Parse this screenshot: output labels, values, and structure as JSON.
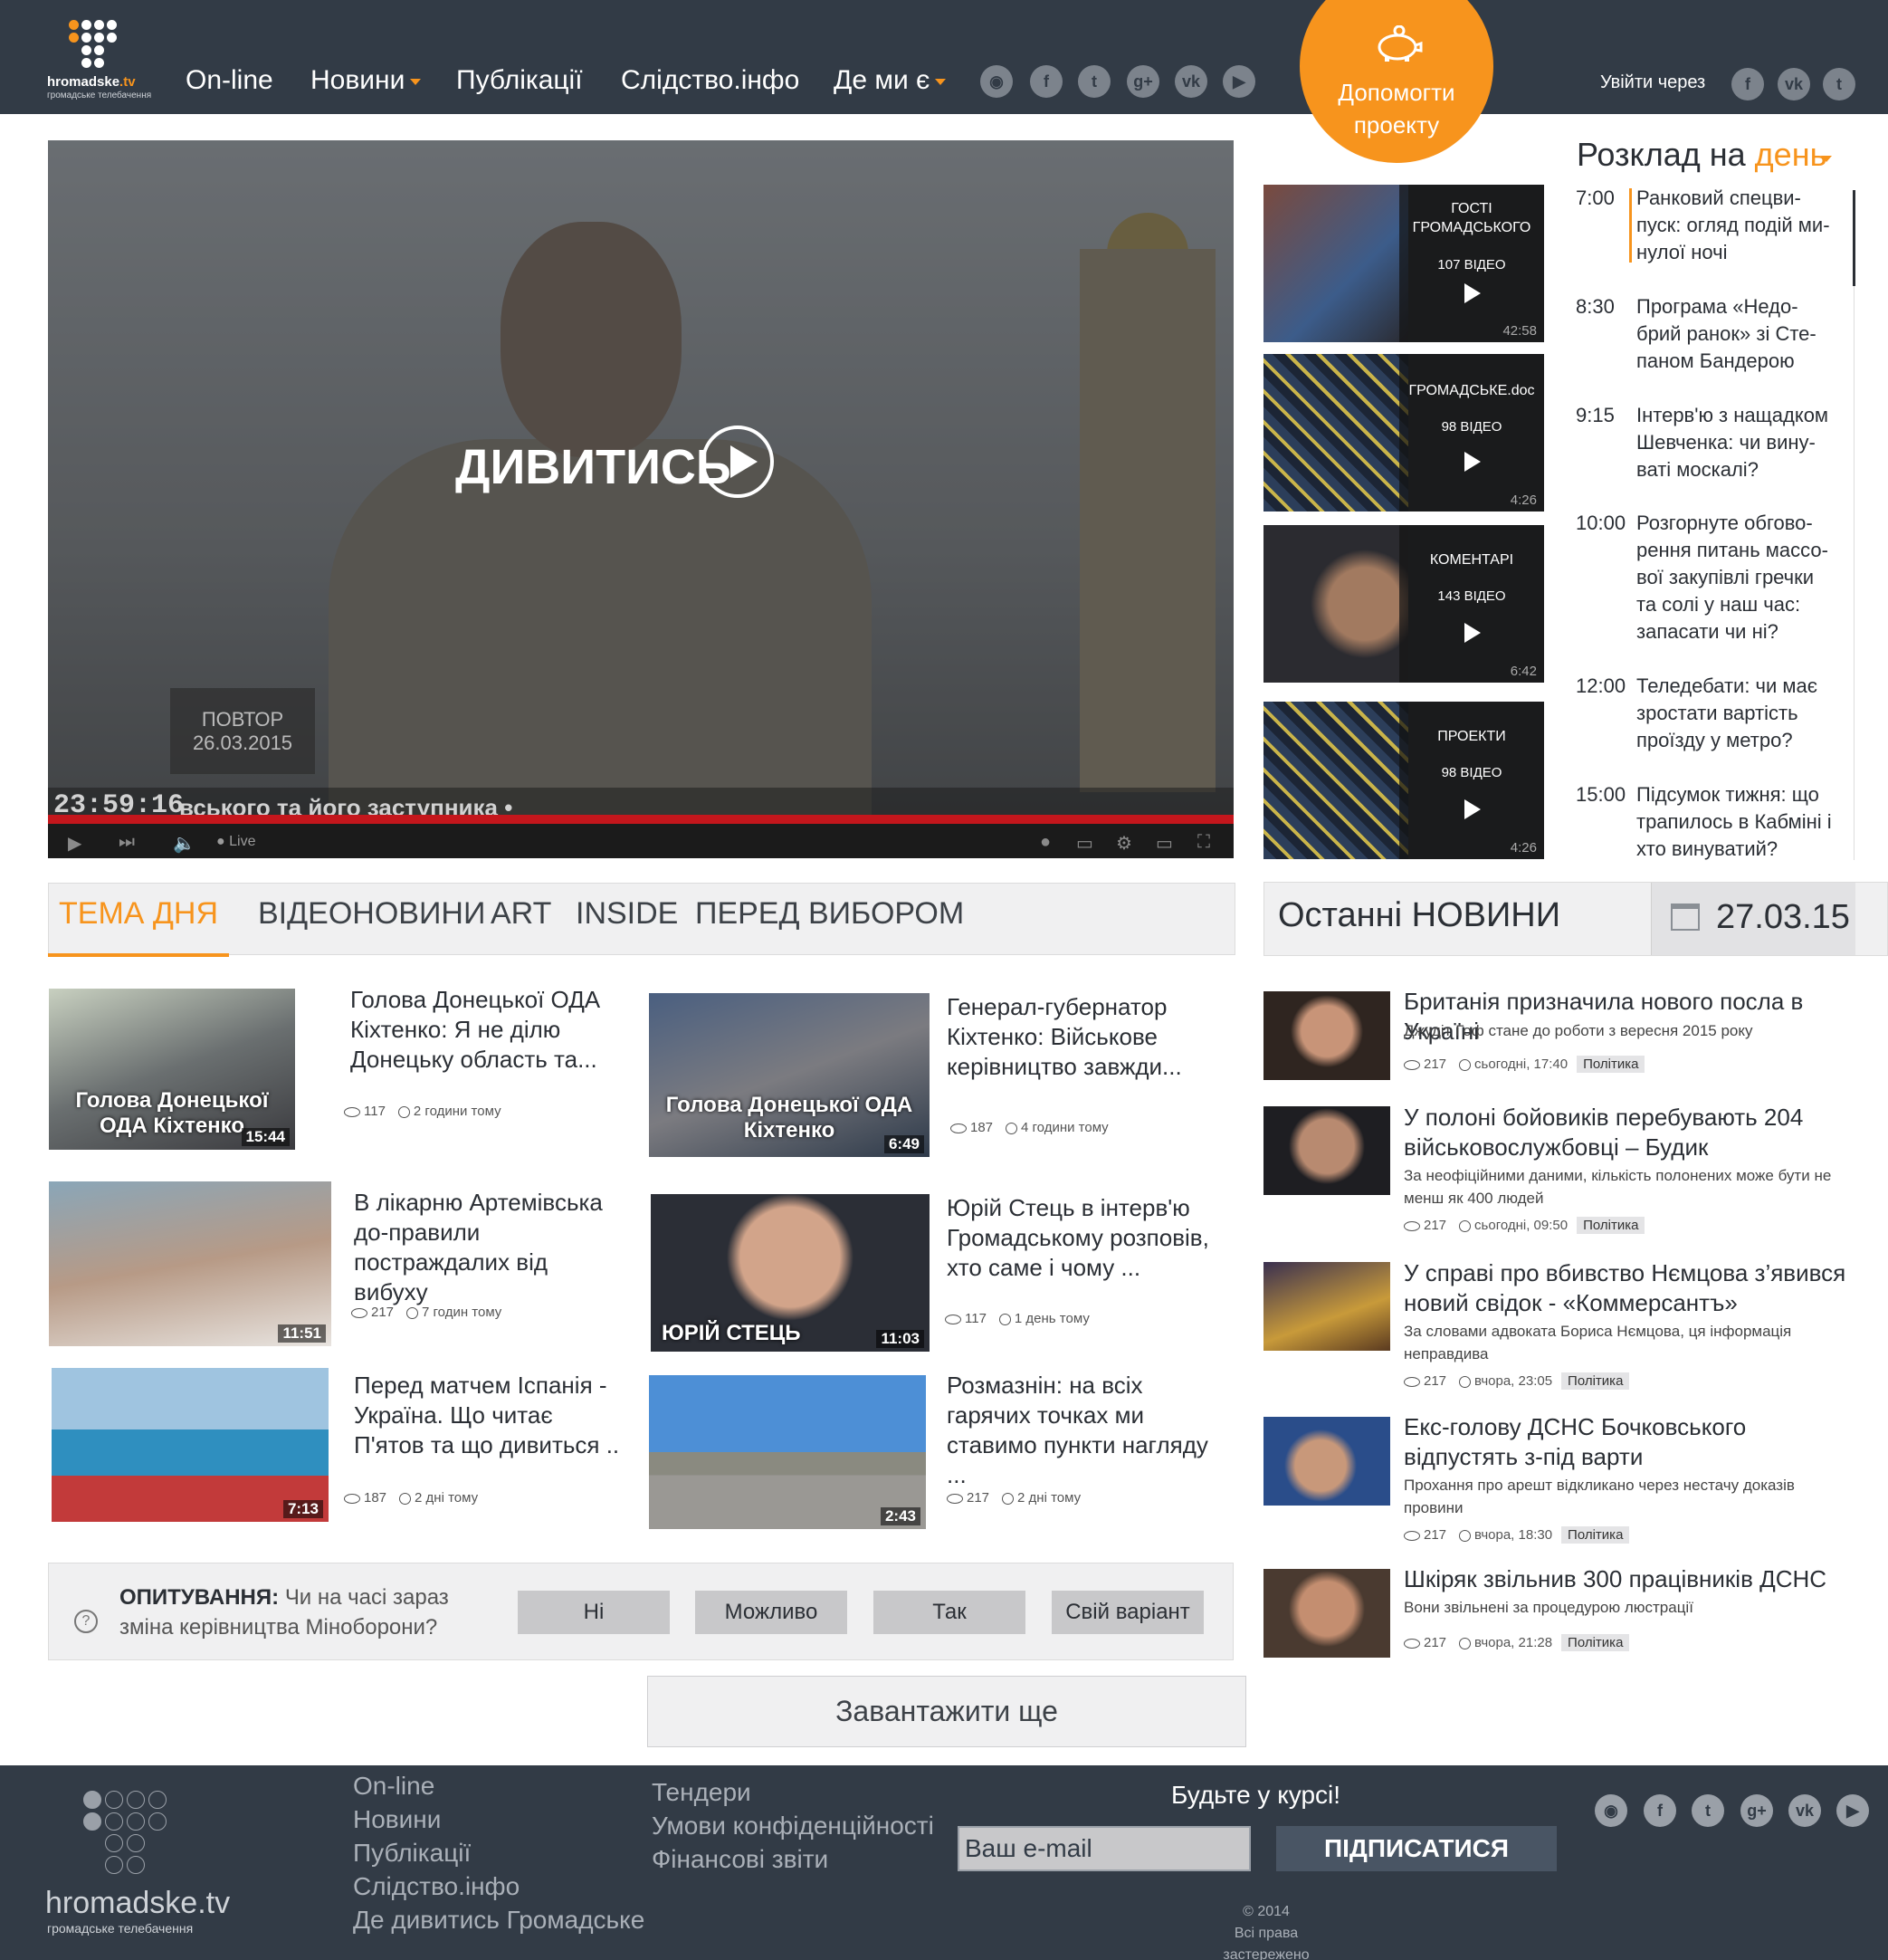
{
  "header": {
    "logo": {
      "name": "hromadske",
      "tld": ".tv",
      "sub": "громадське телебачення"
    },
    "nav": [
      {
        "label": "On-line",
        "dropdown": false
      },
      {
        "label": "Новини",
        "dropdown": true
      },
      {
        "label": "Публікації",
        "dropdown": false
      },
      {
        "label": "Слідство.інфо",
        "dropdown": false
      },
      {
        "label": "Де ми є",
        "dropdown": true
      }
    ],
    "social": [
      "rss-icon",
      "facebook-icon",
      "twitter-icon",
      "google-plus-icon",
      "vk-icon",
      "youtube-icon"
    ],
    "donate": {
      "line1": "Допомогти",
      "line2": "проекту",
      "icon": "piggy-bank-icon"
    },
    "login": {
      "label": "Увійти через",
      "providers": [
        "facebook-icon",
        "vk-icon",
        "twitter-icon"
      ]
    }
  },
  "player": {
    "watch_label": "ДИВИТИСЬ",
    "repeat_line1": "ПОВТОР",
    "repeat_line2": "26.03.2015",
    "clock": "23:59:16",
    "ticker": "вського та його заступника •",
    "live": "● Live"
  },
  "playlists": [
    {
      "title": "ГОСТІ ГРОМАДСЬКОГО",
      "count": "107 ВІДЕО",
      "duration": "42:58"
    },
    {
      "title": "ГРОМАДСЬКЕ.doc",
      "count": "98 ВІДЕО",
      "duration": "4:26"
    },
    {
      "title": "КОМЕНТАРІ",
      "count": "143 ВІДЕО",
      "duration": "6:42"
    },
    {
      "title": "ПРОЕКТИ",
      "count": "98 ВІДЕО",
      "duration": "4:26"
    }
  ],
  "schedule": {
    "title": "Розклад на",
    "period": "день",
    "items": [
      {
        "time": "7:00",
        "text": "Ранковий спецви-пуск: огляд подій ми-нулої ночі"
      },
      {
        "time": "8:30",
        "text": "Програма «Недо-брий ранок» зі Сте-паном Бандерою"
      },
      {
        "time": "9:15",
        "text": "Інтерв'ю з нащадком Шевченка: чи вину-ваті москалі?"
      },
      {
        "time": "10:00",
        "text": "Розгорнуте обгово-рення питань массо-вої закупівлі гречки та солі у наш час: запасати чи ні?"
      },
      {
        "time": "12:00",
        "text": "Теледебати: чи має зростати вартість проїзду у метро?"
      },
      {
        "time": "15:00",
        "text": "Підсумок тижня: що трапилось в Кабміні і хто винуватий?"
      }
    ]
  },
  "tabs": [
    "ТЕМА ДНЯ",
    "ВІДЕОНОВИНИ",
    "ART",
    "INSIDE",
    "ПЕРЕД ВИБОРОМ"
  ],
  "cards": [
    {
      "title": "Голова Донецької ОДА Кіхтенко: Я не ділю Донецьку область та...",
      "views": "117",
      "time": "2 години тому",
      "duration": "15:44",
      "caption": "Голова Донецької ОДА Кіхтенко"
    },
    {
      "title": "Генерал-губернатор Кіхтенко: Військове керівництво завжди...",
      "views": "187",
      "time": "4 години тому",
      "duration": "6:49",
      "caption": "Голова Донецької ОДА Кіхтенко"
    },
    {
      "title": "В лікарню Артемівська до-правили постраждалих від вибуху",
      "views": "217",
      "time": "7 годин тому",
      "duration": "11:51",
      "caption": ""
    },
    {
      "title": "Юрій Стець в інтерв'ю Громадському розповів, хто саме і чому ...",
      "views": "117",
      "time": "1 день тому",
      "duration": "11:03",
      "caption": "ЮРІЙ СТЕЦЬ"
    },
    {
      "title": "Перед матчем Іспанія - Україна. Що читає П'ятов та що дивиться ..",
      "views": "187",
      "time": "2 дні тому",
      "duration": "7:13",
      "caption": ""
    },
    {
      "title": "Розмазнін: на всіх гарячих точках ми ставимо пункти нагляду ...",
      "views": "217",
      "time": "2 дні тому",
      "duration": "2:43",
      "caption": ""
    }
  ],
  "poll": {
    "label": "ОПИТУВАННЯ:",
    "question": "Чи на часі зараз зміна керівництва Міноборони?",
    "options": [
      "Ні",
      "Можливо",
      "Так",
      "Свій варіант"
    ]
  },
  "load_more": "Завантажити ще",
  "latest": {
    "title": "Останні НОВИНИ",
    "date": "27.03.15",
    "items": [
      {
        "title": "Британія призначила нового посла в Україні",
        "sub": "Джудіт Гоф стане до роботи з вересня 2015 року",
        "views": "217",
        "time": "сьогодні, 17:40",
        "tag": "Політика"
      },
      {
        "title": "У полоні бойовиків перебувають 204 військовослужбовці – Будик",
        "sub": "За неофіційними даними, кількість полонених може бути не менш як 400 людей",
        "views": "217",
        "time": "сьогодні, 09:50",
        "tag": "Політика"
      },
      {
        "title": "У справі про вбивство Нємцова з’явився новий свідок - «Коммерсантъ»",
        "sub": "За словами адвоката Бориса Нємцова, ця інформація неправдива",
        "views": "217",
        "time": "вчора, 23:05",
        "tag": "Політика"
      },
      {
        "title": "Екс-голову ДСНС Бочковського відпустять з-під варти",
        "sub": "Прохання про арешт відкликано через нестачу доказів провини",
        "views": "217",
        "time": "вчора, 18:30",
        "tag": "Політика"
      },
      {
        "title": "Шкіряк звільнив 300 працівників ДСНС",
        "sub": "Вони звільнені за процедурою люстрації",
        "views": "217",
        "time": "вчора, 21:28",
        "tag": "Політика"
      }
    ]
  },
  "footer": {
    "logo": {
      "name": "hromadske",
      "tld": ".tv",
      "sub": "громадське телебачення"
    },
    "links1": [
      "On-line",
      "Новини",
      "Публікації",
      "Слідство.інфо",
      "Де дивитись Громадське"
    ],
    "links2": [
      "Тендери",
      "Умови конфіденційності",
      "Фінансові звіти"
    ],
    "stay": "Будьте у курсі!",
    "email_placeholder": "Ваш e-mail",
    "subscribe": "ПІДПИСАТИСЯ",
    "copy1": "© 2014",
    "copy2": "Всі права застережено",
    "social": [
      "rss-icon",
      "facebook-icon",
      "twitter-icon",
      "google-plus-icon",
      "vk-icon",
      "youtube-icon"
    ]
  },
  "colors": {
    "accent": "#f7941d",
    "header_bg": "#323b46",
    "panel_bg": "#f0f0f1"
  }
}
